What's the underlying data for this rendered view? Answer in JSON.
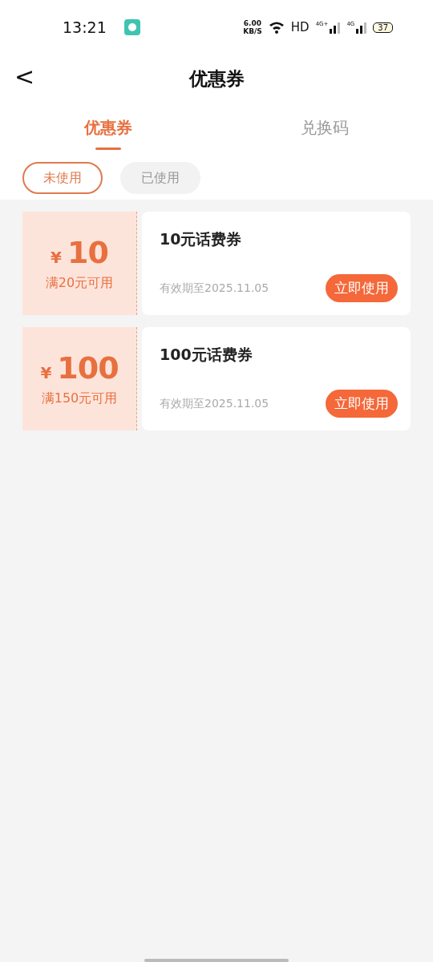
{
  "status_bar": {
    "time": "13:21",
    "speed": "6.00",
    "speed_unit": "KB/S",
    "hd": "HD",
    "signals": [
      {
        "label": "4G+"
      },
      {
        "label": "4G"
      }
    ],
    "battery": "37"
  },
  "header": {
    "back": "<",
    "title": "优惠券"
  },
  "tabs": [
    {
      "label": "优惠券",
      "selected": true
    },
    {
      "label": "兑换码",
      "selected": false
    }
  ],
  "filters": [
    {
      "label": "未使用",
      "selected": true
    },
    {
      "label": "已使用",
      "selected": false
    }
  ],
  "coupons": [
    {
      "currency": "¥",
      "amount": "10",
      "condition": "满20元可用",
      "title": "10元话费券",
      "validity": "有效期至2025.11.05",
      "action": "立即使用"
    },
    {
      "currency": "¥",
      "amount": "100",
      "condition": "满150元可用",
      "title": "100元话费券",
      "validity": "有效期至2025.11.05",
      "action": "立即使用"
    }
  ]
}
